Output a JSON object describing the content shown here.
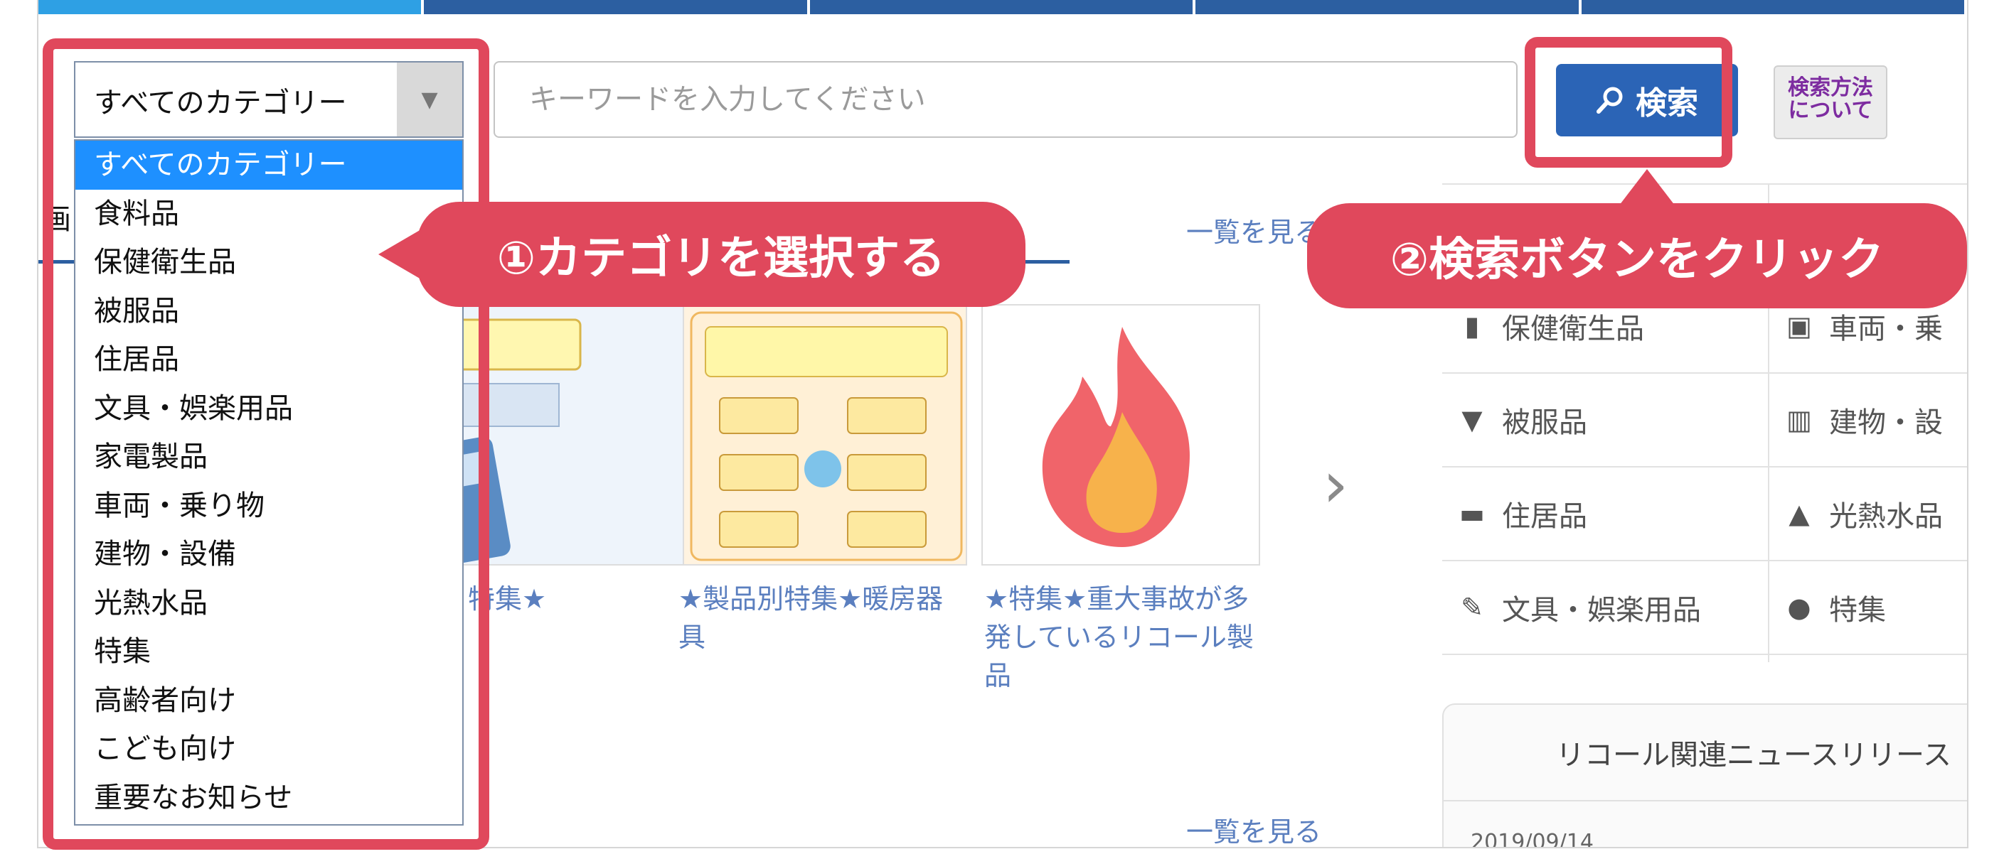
{
  "search": {
    "category_selected": "すべてのカテゴリー",
    "category_options": [
      "すべてのカテゴリー",
      "食料品",
      "保健衛生品",
      "被服品",
      "住居品",
      "文具・娯楽用品",
      "家電製品",
      "車両・乗り物",
      "建物・設備",
      "光熱水品",
      "特集",
      "高齢者向け",
      "こども向け",
      "重要なお知らせ"
    ],
    "keyword_placeholder": "キーワードを入力してください",
    "search_button": "検索",
    "help_button_line1": "検索方法",
    "help_button_line2": "について"
  },
  "annotations": {
    "step1": "①カテゴリを選択する",
    "step2": "②検索ボタンをクリック"
  },
  "main": {
    "section_head_partial": "画",
    "see_all": "一覧を見る",
    "see_all_2": "一覧を見る",
    "cards": [
      {
        "title": "特集★"
      },
      {
        "title": "★製品別特集★暖房器具"
      },
      {
        "title": "★特集★重大事故が多発しているリコール製品"
      }
    ]
  },
  "categories": {
    "left": [
      {
        "label": "保健衛生品",
        "icon": "bottle-icon"
      },
      {
        "label": "被服品",
        "icon": "shirt-icon"
      },
      {
        "label": "住居品",
        "icon": "sofa-icon"
      },
      {
        "label": "文具・娯楽用品",
        "icon": "pencil-icon"
      }
    ],
    "right": [
      {
        "label": "車両・乗",
        "icon": "car-icon"
      },
      {
        "label": "建物・設",
        "icon": "building-icon"
      },
      {
        "label": "光熱水品",
        "icon": "flame-icon"
      },
      {
        "label": "特集",
        "icon": "exclamation-icon"
      }
    ]
  },
  "news": {
    "title": "リコール関連ニュースリリース",
    "date_partial": "2019/09/14"
  },
  "colors": {
    "accent_red": "#e0485c",
    "search_blue": "#2b64b6",
    "selected_blue": "#1e90ff",
    "link_blue": "#5b7fbf"
  }
}
